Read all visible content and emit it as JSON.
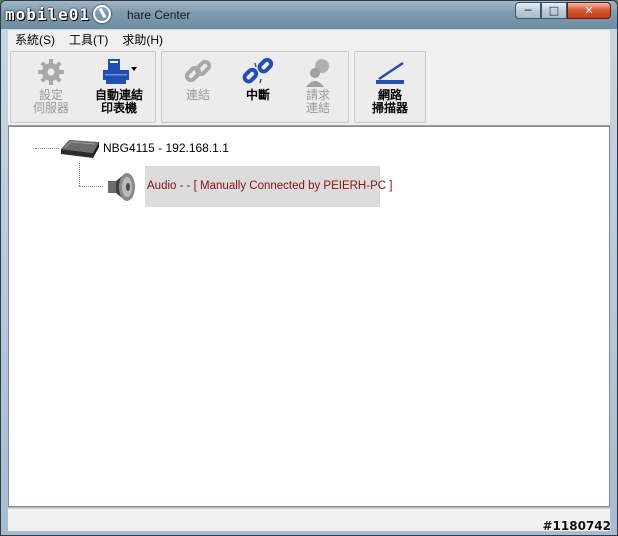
{
  "window": {
    "logo_text": "mobile01",
    "title": "hare Center",
    "caption": {
      "minimize": "─",
      "maximize": "□",
      "close": "✕"
    }
  },
  "menu": [
    "系統(S)",
    "工具(T)",
    "求助(H)"
  ],
  "toolbar": {
    "settings": {
      "label": "設定\n伺服器",
      "icon": "gear-icon",
      "enabled": false
    },
    "auto_connect_printer": {
      "label": "自動連結\n印表機",
      "icon": "printer-icon",
      "enabled": true
    },
    "connect": {
      "label": "連結",
      "icon": "link-icon",
      "enabled": false
    },
    "disconnect": {
      "label": "中斷",
      "icon": "broken-link-icon",
      "enabled": true
    },
    "request_connect": {
      "label": "請求\n連結",
      "icon": "user-request-icon",
      "enabled": false
    },
    "network_scanner": {
      "label": "網路\n掃描器",
      "icon": "scanner-icon",
      "enabled": true
    }
  },
  "tree": {
    "device": {
      "label": "NBG4115 - 192.168.1.1",
      "icon": "router-icon"
    },
    "child": {
      "label": "Audio -  -  [ Manually Connected by PEIERH-PC ]",
      "icon": "speaker-icon",
      "color": "#8a1010"
    }
  },
  "watermark": "#1180742",
  "colors": {
    "accent_blue": "#1f4fb5",
    "disabled_gray": "#9a9a9a"
  }
}
